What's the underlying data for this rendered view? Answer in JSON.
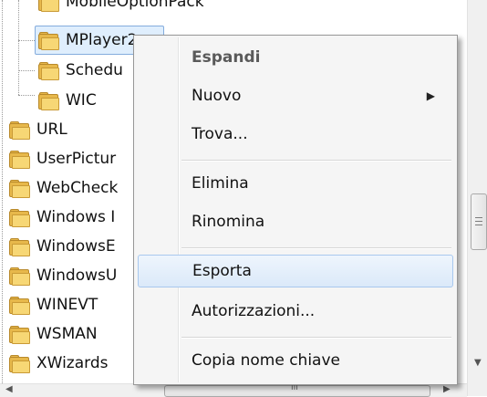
{
  "tree": {
    "subitems": [
      {
        "label": "MobileOptionPack"
      },
      {
        "label": "MPlayer2"
      },
      {
        "label": "Schedu"
      },
      {
        "label": "WIC"
      }
    ],
    "items": [
      {
        "label": "URL"
      },
      {
        "label": "UserPictur"
      },
      {
        "label": "WebCheck"
      },
      {
        "label": "Windows I"
      },
      {
        "label": "WindowsE"
      },
      {
        "label": "WindowsU"
      },
      {
        "label": "WINEVT"
      },
      {
        "label": "WSMAN"
      },
      {
        "label": "XWizards"
      }
    ]
  },
  "context_menu": {
    "expand": "Espandi",
    "new": "Nuovo",
    "find": "Trova...",
    "delete": "Elimina",
    "rename": "Rinomina",
    "export": "Esporta",
    "permissions": "Autorizzazioni...",
    "copy_key_name": "Copia nome chiave"
  },
  "scrollbar": {
    "h_thumb_grip": "III"
  }
}
